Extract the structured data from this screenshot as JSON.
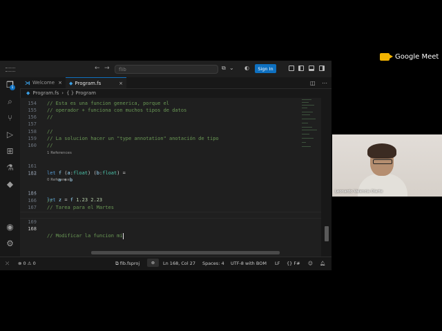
{
  "meet": {
    "logo_text": "Google Meet",
    "participant_name": "Leonardo Valencia Olarte"
  },
  "titlebar": {
    "search_placeholder": "flib",
    "sign_in": "Sign In"
  },
  "tabs": [
    {
      "label": "Welcome"
    },
    {
      "label": "Program.fs"
    }
  ],
  "breadcrumb": {
    "file": "Program.fs",
    "symbol": "{ } Program"
  },
  "activity": {
    "badge": "1"
  },
  "editor": {
    "lines": [
      {
        "num": "154",
        "text": "// Esta es una funcion generica, porque el"
      },
      {
        "num": "155",
        "text": "// operador + funciona con muchos tipos de datos"
      },
      {
        "num": "156",
        "text": "//"
      },
      {
        "num": "157",
        "text": ""
      },
      {
        "num": "158",
        "text": "//"
      },
      {
        "num": "159",
        "text": "// La solucion hacer un \"type annotation\" anotación de tipo"
      },
      {
        "num": "160",
        "text": "//"
      },
      {
        "num": "161",
        "text": "let f (a:float) (b:float) ="
      },
      {
        "num": "162",
        "text": "a + b"
      },
      {
        "num": "163",
        "text": ""
      },
      {
        "num": "164",
        "text": "let z = f 1.23 2.23"
      },
      {
        "num": "165",
        "text": ""
      },
      {
        "num": "166",
        "text": "//"
      },
      {
        "num": "167",
        "text": "// Tarea para el Martes"
      },
      {
        "num": "168",
        "text": "// Modificar la funcion mi"
      },
      {
        "num": "169",
        "text": ""
      }
    ],
    "codelens": {
      "f_refs": "1 References",
      "z_refs": "0 References"
    },
    "code_parts": {
      "let": "let",
      "f": "f",
      "a": "a",
      "b": "b",
      "float": "float",
      "z": "z",
      "n1": "1.23",
      "n2": "2.23",
      "eq": "=",
      "plus": "+"
    }
  },
  "status": {
    "errors": "0",
    "warnings": "0",
    "project": "fib.fsproj",
    "position": "Ln 168, Col 27",
    "spaces": "Spaces: 4",
    "encoding": "UTF-8 with BOM",
    "eol": "LF",
    "language": "F#"
  },
  "icons": {
    "explorer": "files-icon",
    "search": "search-icon",
    "scm": "source-control-icon",
    "debug": "run-debug-icon",
    "extensions": "extensions-icon",
    "testing": "flask-icon",
    "git": "git-icon",
    "account": "account-icon",
    "settings": "gear-icon"
  }
}
